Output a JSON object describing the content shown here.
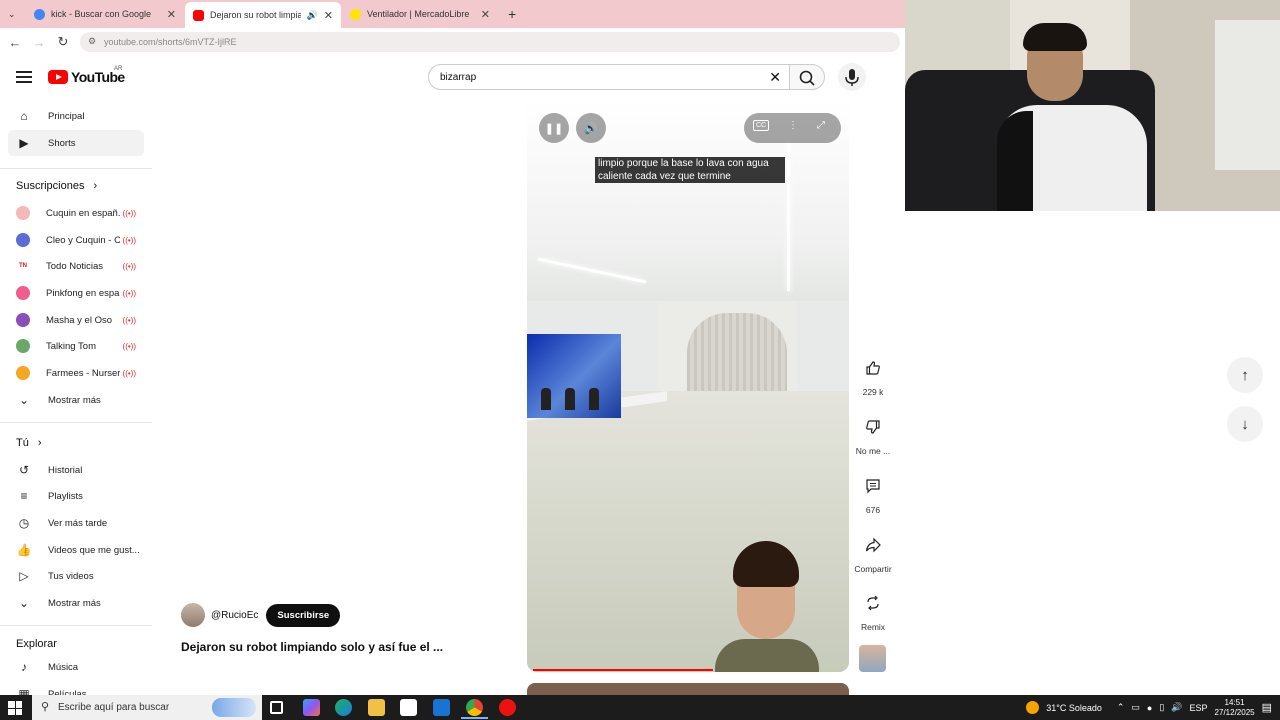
{
  "browser": {
    "tabs": [
      {
        "title": "kick - Buscar con Google",
        "favicon_color": "#4285f4",
        "active": false
      },
      {
        "title": "Dejaron su robot limpiando",
        "favicon_color": "#ff0000",
        "active": true
      },
      {
        "title": "Ventilador | MercadoLibre",
        "favicon_color": "#ffe600",
        "active": false
      }
    ],
    "url": "youtube.com/shorts/6mVTZ-IjlRE"
  },
  "youtube": {
    "logo_text": "YouTube",
    "country_code": "AR",
    "search_value": "bizarrap"
  },
  "sidebar": {
    "primary": [
      {
        "label": "Principal",
        "icon": "home-icon"
      },
      {
        "label": "Shorts",
        "icon": "shorts-icon"
      }
    ],
    "subscriptions_title": "Suscripciones",
    "subscriptions": [
      {
        "label": "Cuquin en españ...",
        "color": "#f4b8b8"
      },
      {
        "label": "Cleo y Cuquin - C...",
        "color": "#5a6fd6"
      },
      {
        "label": "Todo Noticias",
        "color": "#d01818"
      },
      {
        "label": "Pinkfong en espa...",
        "color": "#f05d8b"
      },
      {
        "label": "Masha y el Oso",
        "color": "#8a4fb8"
      },
      {
        "label": "Talking Tom",
        "color": "#6aa86a"
      },
      {
        "label": "Farmees - Nurser...",
        "color": "#f5a623"
      }
    ],
    "show_more": "Mostrar más",
    "you_title": "Tú",
    "you_items": [
      {
        "label": "Historial",
        "icon": "history-icon"
      },
      {
        "label": "Playlists",
        "icon": "playlist-icon"
      },
      {
        "label": "Ver más tarde",
        "icon": "watch-later-icon"
      },
      {
        "label": "Videos que me gust...",
        "icon": "like-icon"
      },
      {
        "label": "Tus videos",
        "icon": "your-videos-icon"
      }
    ],
    "show_more_2": "Mostrar más",
    "explore_title": "Explorar",
    "explore_items": [
      {
        "label": "Música",
        "icon": "music-icon"
      },
      {
        "label": "Películas",
        "icon": "film-icon"
      }
    ]
  },
  "short": {
    "caption": "limpio porque la base lo lava con agua caliente cada vez que termine",
    "channel": "@RucioEc",
    "subscribe_label": "Suscribirse",
    "title": "Dejaron su robot limpiando solo y así fue el ...",
    "progress_fraction": 0.58,
    "actions": [
      {
        "name": "like",
        "icon": "thumbs-up-icon",
        "label": "229 k"
      },
      {
        "name": "dislike",
        "icon": "thumbs-down-icon",
        "label": "No me ..."
      },
      {
        "name": "comments",
        "icon": "comment-icon",
        "label": "676"
      },
      {
        "name": "share",
        "icon": "share-icon",
        "label": "Compartir"
      },
      {
        "name": "remix",
        "icon": "remix-icon",
        "label": "Remix"
      }
    ]
  },
  "taskbar": {
    "search_placeholder": "Escribe aquí para buscar",
    "weather": "31°C  Soleado",
    "language": "ESP",
    "time": "14:51",
    "date": "27/12/2025"
  }
}
